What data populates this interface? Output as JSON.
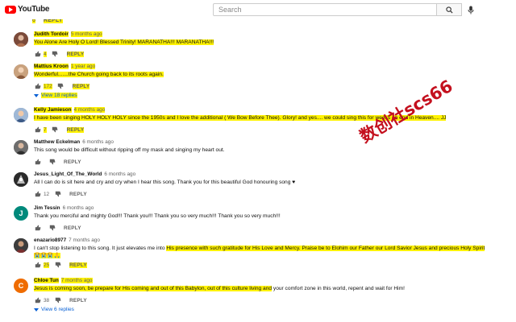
{
  "header": {
    "logo_text": "YouTube",
    "search_placeholder": "Search",
    "icons": {
      "logo": "youtube-play-icon",
      "search": "search-icon",
      "mic": "microphone-icon"
    }
  },
  "watermark": "数创社scs66",
  "previous_comment_tail": {
    "likes": "6",
    "reply_label": "REPLY"
  },
  "comments": [
    {
      "author": "Judith Tordoir",
      "time": "5 months ago",
      "text": "You Alone Are Holy O Lord! Blessed Trinity! MARANATHA!!! MARANATHA!!!",
      "likes": "4",
      "reply_label": "REPLY",
      "avatar_color": "#7b4a3a"
    },
    {
      "author": "Mattius Kroon",
      "time": "1 year ago",
      "text": "Wonderful.......the Church going back to its roots again.",
      "likes": "172",
      "reply_label": "REPLY",
      "view_replies": "View 18 replies",
      "avatar_color": "#a87a5a"
    },
    {
      "author": "Kelly Jamieson",
      "time": "4 months ago",
      "text": "I have been singing HOLY HOLY HOLY since the 1950s and I love the additional ( We Bow Before Thee). Glory! and yes.... we could sing this for weeks on end in Heaven.... JJ",
      "likes": "7",
      "reply_label": "REPLY",
      "avatar_color": "#5d7fa8"
    },
    {
      "author": "Matthew Eckelman",
      "time": "6 months ago",
      "text": "This song would be difficult without ripping off my mask and singing my heart out.",
      "likes": "",
      "reply_label": "REPLY",
      "avatar_color": "#8a8a8a"
    },
    {
      "author": "Jesus_Light_Of_The_World",
      "time": "6 months ago",
      "text": "All I can do is sit here and cry and cry when I hear this song. Thank you for this beautiful God honouring song ♥",
      "likes": "12",
      "reply_label": "REPLY",
      "avatar_color": "#333333"
    },
    {
      "author": "Jim Tessin",
      "time": "6 months ago",
      "text": "Thank you merciful and mighty God!!! Thank you!!! Thank you so very much!!! Thank you so very much!!!",
      "likes": "",
      "reply_label": "REPLY",
      "avatar_letter": "J",
      "avatar_color": "#00897b"
    },
    {
      "author": "enazario8977",
      "time": "7 months ago",
      "text_plain": "I can't stop listening to this song. It just elevates me into ",
      "text_highlight": "His presence with such gratitude for His Love and Mercy. Praise be to Elohim our Father our Lord Savior Jesus and precious Holy Spirit",
      "text_line2": "😭😭😭🙏",
      "likes": "25",
      "reply_label": "REPLY",
      "avatar_color": "#4a4a4a"
    },
    {
      "author": "Chloe Tun",
      "time": "7 months ago",
      "text_highlight": "Jesus is coming soon, be prepare for His coming and out of this Babylon, out of this culture living and",
      "text_plain": " your comfort zone in this world, repent and wait for Him!",
      "likes": "38",
      "reply_label": "REPLY",
      "view_replies": "View 6 replies",
      "avatar_letter": "C",
      "avatar_color": "#ef6c00"
    }
  ]
}
